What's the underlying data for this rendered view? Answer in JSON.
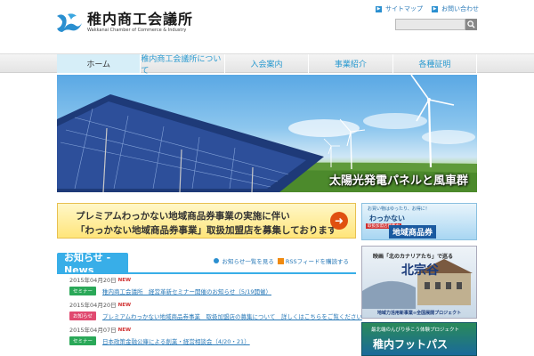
{
  "site": {
    "name": "稚内商工会議所",
    "name_en": "Wakkanai Chamber of Commerce & Industry"
  },
  "header": {
    "links": [
      {
        "label": "サイトマップ",
        "icon": "arrow-right-icon"
      },
      {
        "label": "お問い合わせ",
        "icon": "arrow-right-icon"
      }
    ],
    "search": {
      "placeholder": "",
      "button_icon": "search-icon"
    }
  },
  "nav": {
    "items": [
      {
        "label": "ホーム",
        "active": true
      },
      {
        "label": "稚内商工会議所について",
        "active": false
      },
      {
        "label": "入会案内",
        "active": false
      },
      {
        "label": "事業紹介",
        "active": false
      },
      {
        "label": "各種証明",
        "active": false
      }
    ]
  },
  "hero": {
    "caption": "太陽光発電パネルと風車群"
  },
  "promo": {
    "line1": "プレミアムわっかない地域商品券事業の実施に伴い",
    "line2": "「わっかない地域商品券事業」取扱加盟店を募集しております",
    "arrow_icon": "arrow-right-icon"
  },
  "side_banners": {
    "voucher": {
      "small": "お買い物はゆったり、お得に！",
      "mid": "わっかない",
      "tag": "取扱加盟店募集中",
      "big": "地域商品券"
    },
    "movie": {
      "line": "映画「北のカナリアたち」で巡る",
      "title": "北宗谷",
      "foot": "地域力活用新事業∞全国展開プロジェクト"
    },
    "footpath": {
      "top": "最北端のんびり歩こう体験プロジェクト",
      "title": "稚内フットパス"
    }
  },
  "news": {
    "tab_label": "お知らせ - News",
    "links": [
      {
        "label": "お知らせ一覧を見る",
        "icon": "bullet-icon"
      },
      {
        "label": "RSSフィードを購読する",
        "icon": "rss-icon"
      }
    ],
    "items": [
      {
        "date": "2015年04月20日",
        "new": "NEW",
        "category": "セミナー",
        "cat_type": "seminar",
        "title": "稚内商工会議所　経営革新セミナー開催のお知らせ（5/19開催）"
      },
      {
        "date": "2015年04月20日",
        "new": "NEW",
        "category": "お知らせ",
        "cat_type": "notice",
        "title": "プレミアムわっかない地域商品券事業　取扱加盟店の募集について　詳しくはこちらをご覧ください"
      },
      {
        "date": "2015年04月07日",
        "new": "NEW",
        "category": "セミナー",
        "cat_type": "seminar",
        "title": "日本政策金融公庫による創業・経営相談会（4/20・21）"
      }
    ]
  },
  "colors": {
    "accent": "#38aee8",
    "link": "#2a7ab8",
    "seminar": "#2aa858",
    "notice": "#e04a70"
  }
}
